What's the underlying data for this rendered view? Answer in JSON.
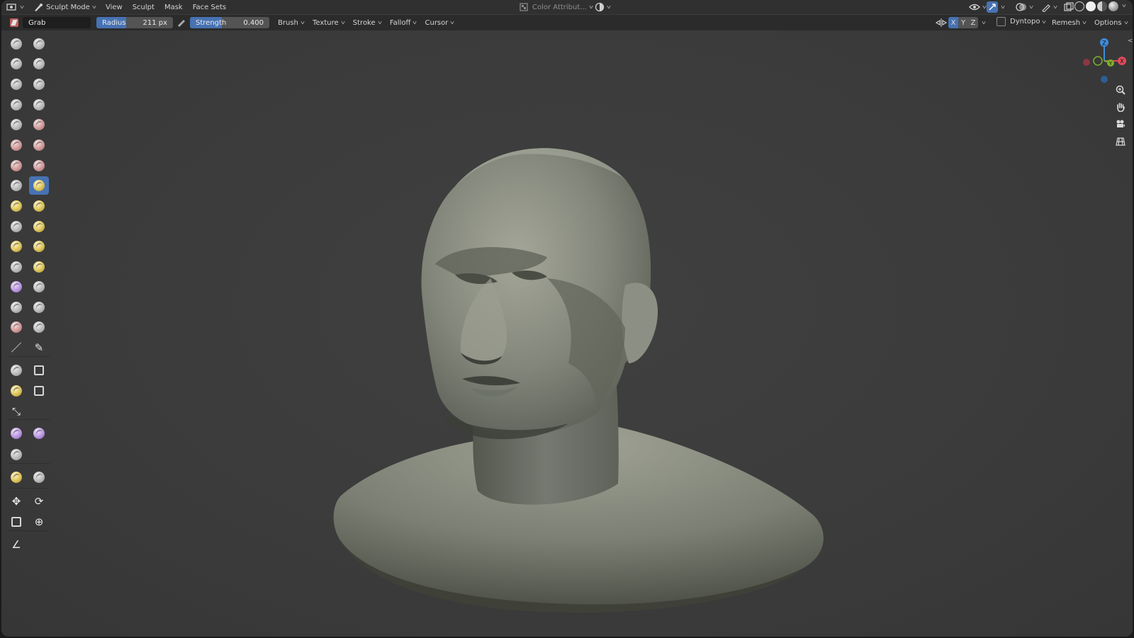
{
  "header": {
    "editor_icon": "editor-type-icon",
    "mode_label": "Sculpt Mode",
    "menus": [
      "View",
      "Sculpt",
      "Mask",
      "Face Sets"
    ],
    "color_attribute_label": "Color Attribut..."
  },
  "toolbar": {
    "brush_name": "Grab",
    "radius_label": "Radius",
    "radius_value": "211 px",
    "strength_label": "Strength",
    "strength_value": "0.400",
    "strength_fraction": 0.4,
    "dropdowns": [
      "Brush",
      "Texture",
      "Stroke",
      "Falloff",
      "Cursor"
    ],
    "symmetry_axes": [
      "X",
      "Y",
      "Z"
    ],
    "dyntopo_label": "Dyntopo",
    "remesh_label": "Remesh",
    "options_label": "Options"
  },
  "gizmo": {
    "x": "X",
    "y": "Y",
    "z": "Z",
    "x_color": "#e24a5c",
    "y_color": "#7db02c",
    "z_color": "#3f8bd9"
  },
  "colors": {
    "accent": "#4772b3",
    "header_bg": "#303030",
    "viewport_bg": "#3c3c3c"
  }
}
